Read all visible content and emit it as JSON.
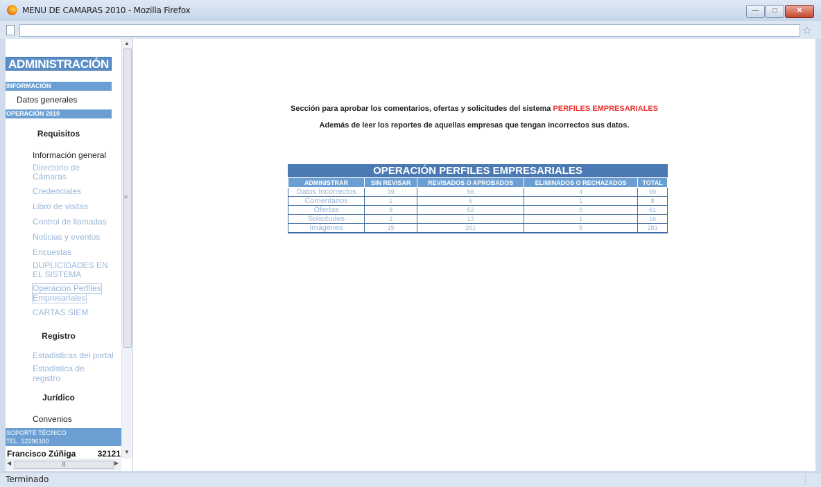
{
  "window": {
    "title": "MENU DE CAMARAS 2010 - Mozilla Firefox",
    "status": "Terminado"
  },
  "sidebar": {
    "title": "ADMINISTRACIÓN",
    "sections": {
      "info": "INFORMACIÓN",
      "datos": "Datos generales",
      "op": "OPERACIÓN 2010",
      "req": "Requisitos",
      "registro": "Registro",
      "juridico": "Jurídico"
    },
    "links": {
      "info_general": "Información general",
      "directorio_1": "Directorio de",
      "directorio_2": "Cámaras",
      "credenciales": "Credenciales",
      "libro": "Libro de visitas",
      "llamadas": "Control de llamadas",
      "noticias": "Noticias y eventos",
      "encuestas": "Encuestas",
      "dup_1": "DUPLICIDADES EN",
      "dup_2": "EL SISTEMA",
      "op_perf_1": "Operación Perfiles",
      "op_perf_2": "Empresariales",
      "cartas": "CARTAS SIEM",
      "estad_portal": "Estadisticas del portal",
      "estad_reg_1": "Estadistica de",
      "estad_reg_2": "registro",
      "convenios": "Convenios"
    },
    "support_1": "SOPORTE TÉCNICO",
    "support_2": "TEL. 52296100",
    "user_name": "Francisco Zúñiga",
    "user_ext": "32121"
  },
  "main": {
    "intro_a": "Sección para aprobar los comentarios, ofertas y solicitudes del sistema ",
    "intro_highlight": "PERFILES EMPRESARIALES",
    "intro_b": "Además de leer los reportes de aquellas empresas que tengan incorrectos sus datos.",
    "table": {
      "title": "OPERACIÓN PERFILES EMPRESARIALES",
      "headers": [
        "ADMINISTRAR",
        "SIN REVISAR",
        "REVISADOS O APROBADOS",
        "ELIMINADOS O RECHAZADOS",
        "TOTAL"
      ],
      "rows": [
        [
          "Datos Incorrectos",
          "39",
          "56",
          "4",
          "99"
        ],
        [
          "Comentarios",
          "1",
          "6",
          "1",
          "8"
        ],
        [
          "Ofertas",
          "9",
          "52",
          "0",
          "61"
        ],
        [
          "Solicitudes",
          "2",
          "13",
          "1",
          "16"
        ],
        [
          "Imágenes",
          "15",
          "261",
          "5",
          "281"
        ]
      ]
    }
  }
}
